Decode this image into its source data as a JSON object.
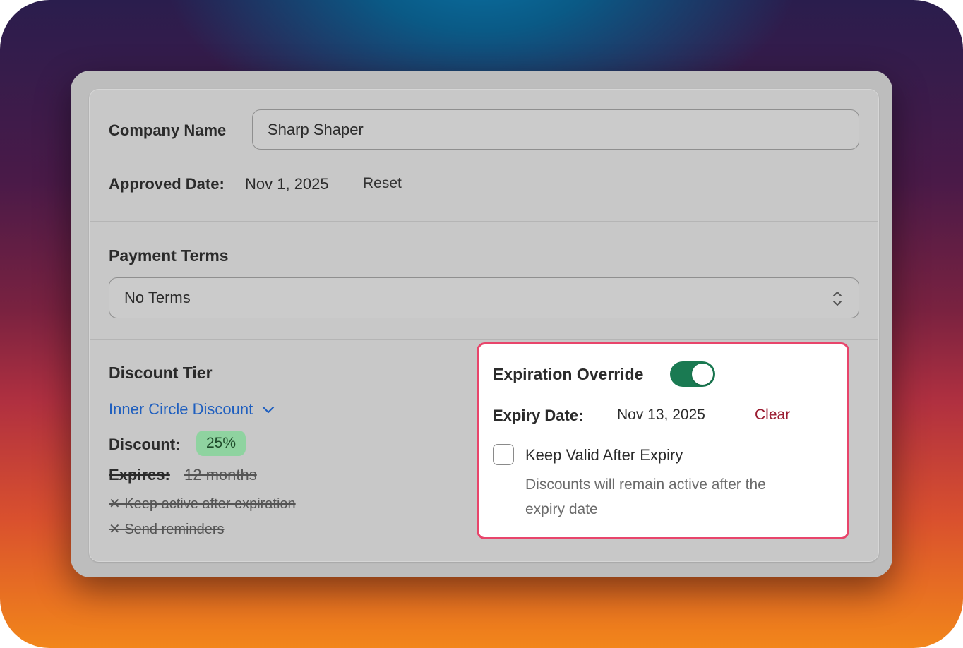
{
  "company": {
    "label": "Company Name",
    "value": "Sharp Shaper"
  },
  "approved": {
    "label": "Approved Date:",
    "value": "Nov 1, 2025",
    "reset_label": "Reset"
  },
  "payment_terms": {
    "heading": "Payment Terms",
    "selected": "No Terms"
  },
  "discount_tier": {
    "heading": "Discount Tier",
    "selected": "Inner Circle Discount",
    "discount_label": "Discount:",
    "discount_value": "25%",
    "expires_label": "Expires:",
    "expires_value": "12 months",
    "features": [
      "✕ Keep active after expiration",
      "✕ Send reminders"
    ]
  },
  "override": {
    "title": "Expiration Override",
    "toggle_on": true,
    "expiry_label": "Expiry Date:",
    "expiry_value": "Nov 13, 2025",
    "clear_label": "Clear",
    "checkbox_label": "Keep Valid After Expiry",
    "checkbox_checked": false,
    "help_line1": "Discounts will remain active after the",
    "help_line2": "expiry date"
  },
  "colors": {
    "link": "#1f5fbf",
    "clear": "#9a1b30",
    "toggle": "#1a7a52",
    "highlight_border": "#e8456b",
    "badge": "#8fd3a0"
  },
  "icons": {
    "select_chevrons": "updown-chevrons-icon",
    "dropdown": "chevron-down-icon"
  }
}
